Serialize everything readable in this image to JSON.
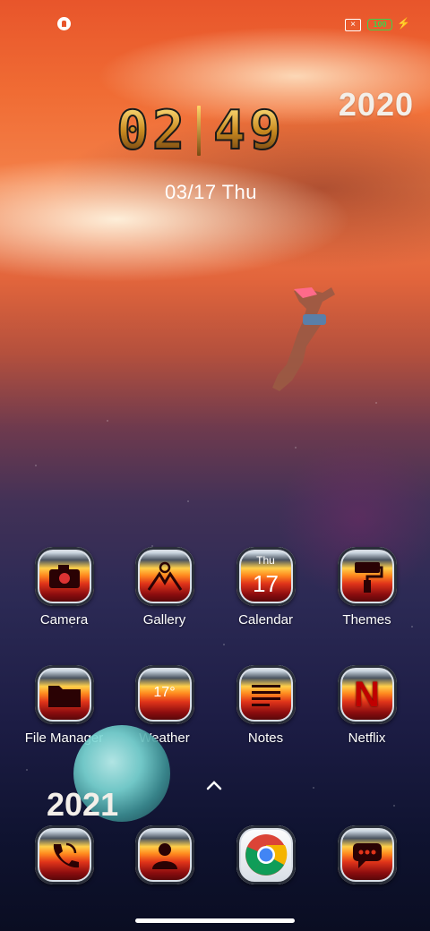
{
  "status_bar": {
    "notification_icon": "app-notification-icon",
    "sim_icon": "no-sim-icon",
    "battery_level": "100",
    "battery_color": "#3cd34b",
    "charging_icon": "lightning-icon"
  },
  "clock": {
    "hour_tens": "0",
    "hour_ones": "2",
    "minute_tens": "4",
    "minute_ones": "9",
    "year_top": "2020",
    "date": "03/17",
    "weekday": "Thu"
  },
  "apps": {
    "camera": {
      "label": "Camera",
      "icon": "camera-icon"
    },
    "gallery": {
      "label": "Gallery",
      "icon": "mountain-icon"
    },
    "calendar": {
      "label": "Calendar",
      "icon": "calendar-icon",
      "day_name": "Thu",
      "day_number": "17"
    },
    "themes": {
      "label": "Themes",
      "icon": "paint-roller-icon"
    },
    "file_manager": {
      "label": "File Manager",
      "icon": "folder-icon"
    },
    "weather": {
      "label": "Weather",
      "icon": "weather-icon",
      "temp": "17°"
    },
    "notes": {
      "label": "Notes",
      "icon": "lines-icon"
    },
    "netflix": {
      "label": "Netflix",
      "icon": "netflix-icon",
      "letter": "N"
    }
  },
  "dock": {
    "phone": {
      "icon": "phone-icon"
    },
    "contacts": {
      "icon": "person-icon"
    },
    "chrome": {
      "icon": "chrome-icon"
    },
    "messages": {
      "icon": "message-bubble-icon"
    }
  },
  "year_bottom": "2021",
  "drawer_hint_icon": "chevron-up-icon",
  "accent": "#e0341a"
}
